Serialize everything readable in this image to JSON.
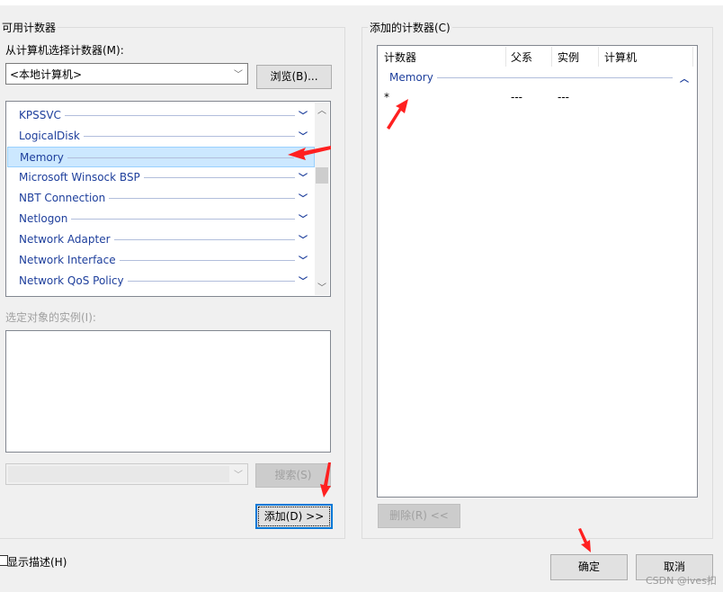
{
  "left": {
    "group_title": "可用计数器",
    "computer_label": "从计算机选择计数器(M):",
    "computer_value": "<本地计算机>",
    "browse_label": "浏览(B)...",
    "counters": [
      {
        "label": "KPSSVC"
      },
      {
        "label": "LogicalDisk"
      },
      {
        "label": "Memory",
        "selected": true
      },
      {
        "label": "Microsoft Winsock BSP"
      },
      {
        "label": "NBT Connection"
      },
      {
        "label": "Netlogon"
      },
      {
        "label": "Network Adapter"
      },
      {
        "label": "Network Interface"
      },
      {
        "label": "Network QoS Policy"
      }
    ],
    "instances_label": "选定对象的实例(I):",
    "search_value": "",
    "search_label": "搜索(S)",
    "add_label": "添加(D) >>"
  },
  "right": {
    "group_title": "添加的计数器(C)",
    "columns": [
      "计数器",
      "父系",
      "实例",
      "计算机"
    ],
    "group_name": "Memory",
    "rows": [
      {
        "counter": "*",
        "parent": "---",
        "instance": "---",
        "computer": ""
      }
    ],
    "delete_label": "删除(R) <<"
  },
  "footer": {
    "show_desc_label": "显示描述(H)",
    "show_desc_checked": false,
    "ok_label": "确定",
    "cancel_label": "取消"
  },
  "watermark": "CSDN @ives扣",
  "colors": {
    "accent": "#0078d7",
    "item_text": "#1e3f9c",
    "selection": "#cce8ff",
    "annotation_arrow": "#ff2020"
  }
}
